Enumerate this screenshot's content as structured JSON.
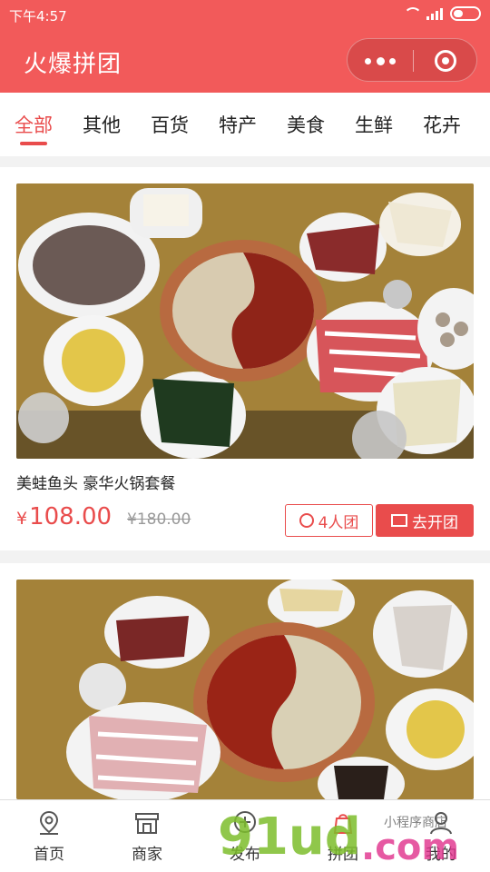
{
  "status_bar": {
    "time": "下午4:57"
  },
  "header": {
    "title": "火爆拼团",
    "capsule": {
      "more_icon": "more-dots-icon",
      "close_icon": "target-circle-icon"
    }
  },
  "tabs": [
    {
      "label": "全部",
      "active": true
    },
    {
      "label": "其他",
      "active": false
    },
    {
      "label": "百货",
      "active": false
    },
    {
      "label": "特产",
      "active": false
    },
    {
      "label": "美食",
      "active": false
    },
    {
      "label": "生鲜",
      "active": false
    },
    {
      "label": "花卉",
      "active": false
    }
  ],
  "products": [
    {
      "title": "美蛙鱼头 豪华火锅套餐",
      "currency": "¥",
      "price": "108.00",
      "original_price": "¥180.00",
      "group_size": "4人团",
      "open_group_label": "去开团"
    }
  ],
  "bottom_nav": [
    {
      "label": "首页",
      "icon": "location-pin-icon"
    },
    {
      "label": "商家",
      "icon": "store-icon"
    },
    {
      "label": "发布",
      "icon": "plus-circle-icon"
    },
    {
      "label": "拼团",
      "icon": "group-buy-icon"
    },
    {
      "label": "我的",
      "icon": "user-icon"
    }
  ],
  "watermark": {
    "text": "91ud.com",
    "subtext": "小程序商店"
  },
  "colors": {
    "brand_red": "#f25a5a",
    "accent_red": "#e94c4c"
  }
}
